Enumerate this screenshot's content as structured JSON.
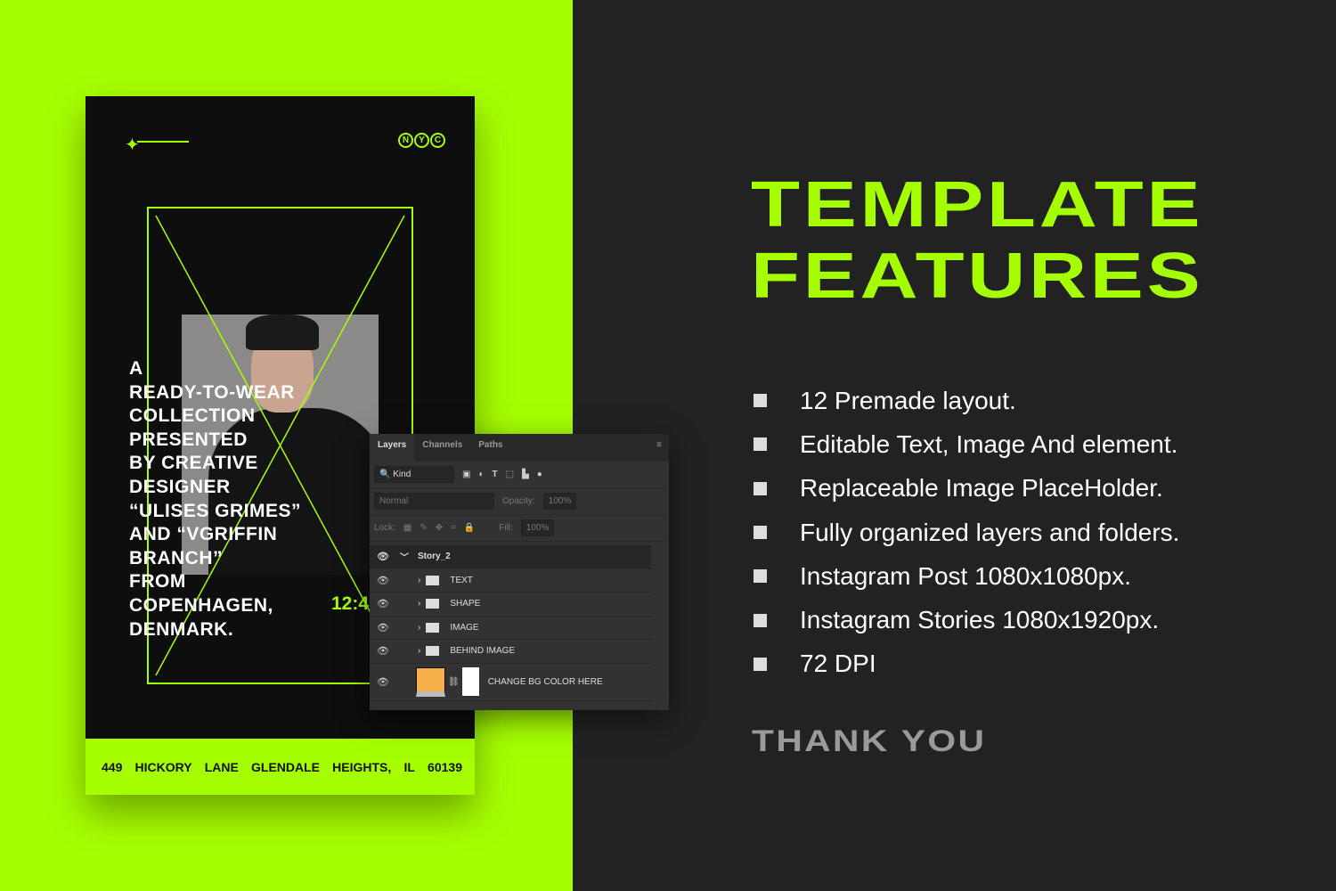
{
  "colors": {
    "accent": "#a6ff00",
    "background": "#222222",
    "card": "#0e0e0e",
    "swatch": "#f5b04b"
  },
  "story": {
    "badge": [
      "N",
      "Y",
      "C"
    ],
    "text": "A READY-TO-WEAR COLLECTION PRESENTED BY CREATIVE DESIGNER “ULISES GRIMES” AND “VGRIFFIN BRANCH” FROM COPENHAGEN, DENMARK.",
    "lines": [
      "A",
      "READY-TO-WEAR",
      "COLLECTION",
      "PRESENTED",
      "BY CREATIVE",
      "DESIGNER",
      "“ULISES GRIMES”",
      "AND “VGRIFFIN",
      "BRANCH”",
      "FROM",
      "COPENHAGEN,",
      "DENMARK."
    ],
    "time": "12:4",
    "footer": [
      "449",
      "HICKORY",
      "LANE",
      "GLENDALE",
      "HEIGHTS,",
      "IL",
      "60139"
    ]
  },
  "panel": {
    "tabs": [
      "Layers",
      "Channels",
      "Paths"
    ],
    "filter": "Kind",
    "blend": "Normal",
    "opacity_label": "Opacity:",
    "opacity": "100%",
    "lock_label": "Lock:",
    "fill_label": "Fill:",
    "fill": "100%",
    "group": "Story_2",
    "folders": [
      "TEXT",
      "SHAPE",
      "IMAGE",
      "BEHIND IMAGE"
    ],
    "bg_layer": "CHANGE BG COLOR HERE"
  },
  "title": [
    "TEMPLATE",
    "FEATURES"
  ],
  "features": [
    "12 Premade layout.",
    "Editable Text, Image And element.",
    "Replaceable Image PlaceHolder.",
    "Fully organized layers and folders.",
    "Instagram Post 1080x1080px.",
    "Instagram Stories 1080x1920px.",
    "72 DPI"
  ],
  "thanks": "THANK YOU"
}
